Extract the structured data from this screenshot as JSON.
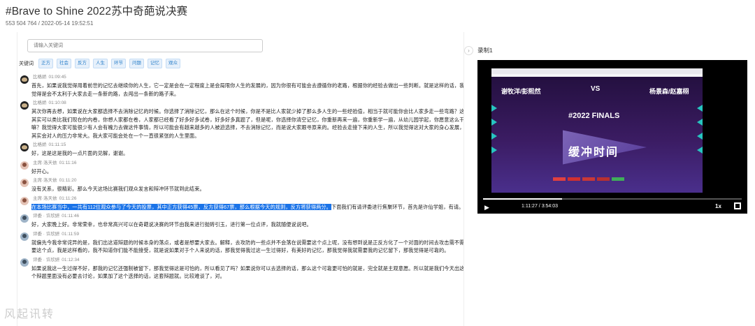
{
  "page": {
    "title": "#Brave to Shine 2022苏中奇葩说决赛",
    "meta_id": "553 504 764",
    "meta_date": "2022-05-14 19:52:51"
  },
  "search": {
    "placeholder": "请输入关键词"
  },
  "keywords": {
    "label": "关键词",
    "tags": [
      "正方",
      "社会",
      "反方",
      "人生",
      "环节",
      "问题",
      "记忆",
      "观众"
    ]
  },
  "transcript": [
    {
      "speaker": "比格娇",
      "time": "01:09:45",
      "avatar": "witch",
      "text": "首先，如果说我觉得用着前世的记忆去继续你的人生，它一定是会在一定程度上是会局限你人生的发展的，因为你很有可能会去遵循你的老路，根据你的经验去做出一些判断。就是这样的话，我觉得是会不太利于大家去走一条新的路，去闯出一条新的路子来。"
    },
    {
      "speaker": "比格娇",
      "time": "01:10:08",
      "avatar": "witch",
      "text": "其次你再去想，如果说在大家都选择不去消除记忆的时候。你选择了消除记忆，那么在这个时候，你是不是比人家就少掉了那么多人生的一些经验值，相当于就可能你会比人家多走一些弯路？这其实可以类比我们现在的内卷，你想人家都在卷，人家都已经看了好多好多试卷，好多好多真题了，但是呢，你选择你清空记忆，你重新再来一遍，你重新学一遍，从幼儿园学起，你愿意这么干嘛？我觉得大家可能很少有人会有魄力去做这件事情，所以可能会有越来越多的人被迫选择，不去消除记忆，而是说大家跟寻原来的。经验去走接下来的人生，所以我觉得这对大家的身心发展，其实会对人的压力非常大。我大家可能会处在一个一直很紧张的人生里面。"
    },
    {
      "speaker": "比格娇",
      "time": "01:11:15",
      "avatar": "witch",
      "text": "好，这是这是我的一点片面的见解，谢谢。"
    },
    {
      "speaker": "主席·洛天依",
      "time": "01:11:16",
      "avatar": "host",
      "text": "好开心。"
    },
    {
      "speaker": "主席·洛天依",
      "time": "01:11:20",
      "avatar": "host",
      "text": "没有关系，很精彩。那么今天这场比赛我们观众发言和辩冲环节就到此结束。"
    },
    {
      "speaker": "主席·洛天依",
      "time": "01:11:26",
      "avatar": "host",
      "highlight": "在本场比赛当中，一共有112位观众参与了今天的投票，其中正方获得45票，反方获得67票，那么根据今天的规则，反方将获得两分。",
      "text": "下面我们有请评委进行焦聚环节，首先是许仙学姐，有请。"
    },
    {
      "speaker": "评委 · 许欣妍",
      "time": "01:11:46",
      "avatar": "judge",
      "text": "好，大家晚上好。非常荣幸，也非常高兴可以在奇葩说决赛的环节由我来进行抛砖引玉，进行第一位点评，我就随便说说吧。"
    },
    {
      "speaker": "评委 · 许欣妍",
      "time": "01:11:59",
      "avatar": "judge",
      "text": "就偏先今我非常诧异的是，我们出这道辩题的时候本身的落点，或者是想要大家去。解释，去攻防的一些点并不会落在说需要这个点上呢，没有想到说是正反方化了一个对面的时间去攻击需不需要这个点，我是这样看的，我不知道你们能不能接受，就是说如果对于个人来说的话，那我觉得我过这一生过得好，有美好的记忆，那我觉得我就需要我的记忆留下，那我觉得是可靠的。"
    },
    {
      "speaker": "评委 · 许欣妍",
      "time": "01:12:34",
      "avatar": "judge",
      "text": "如果说我这一生过得不好，那我的记忆还强制被留下，那我觉得这是可怕的，所以看见了吗？如果说你可以去选择的话，那么这个可靠更可怕的就是，完全就是主观意愿。所以就是我们今天出这个辩题里面没有必要去讨论，如果加了这个选择的话，这套辩题就。比较难谈了，对。"
    }
  ],
  "right": {
    "title": "录制1",
    "video": {
      "team_left": "谢牧洋/彭熙然",
      "team_right": "杨景森/赵嘉栩",
      "vs": "VS",
      "finals": "#2022 FINALS",
      "buffer": "缓冲时间",
      "time_current": "1:11:27",
      "time_total": "3:54:03",
      "time_sep": " / ",
      "speed": "1x",
      "progress": 0.305,
      "play_glyph": "▶"
    }
  },
  "watermark": "风起讯转"
}
